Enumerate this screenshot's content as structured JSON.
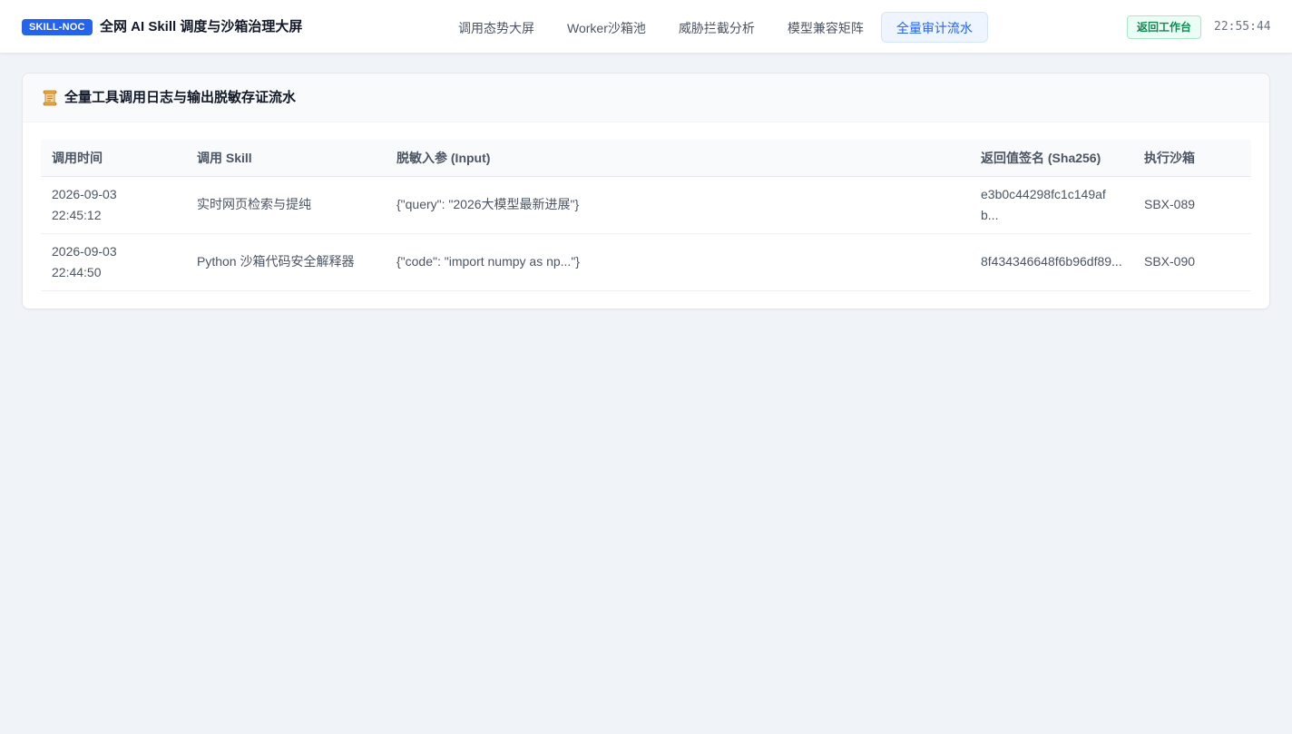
{
  "header": {
    "badge": "SKILL-NOC",
    "title": "全网 AI Skill 调度与沙箱治理大屏",
    "tabs": [
      {
        "label": "调用态势大屏",
        "active": false
      },
      {
        "label": "Worker沙箱池",
        "active": false
      },
      {
        "label": "威胁拦截分析",
        "active": false
      },
      {
        "label": "模型兼容矩阵",
        "active": false
      },
      {
        "label": "全量审计流水",
        "active": true
      }
    ],
    "workbench_button": "返回工作台",
    "clock": "22:55:44"
  },
  "audit_card": {
    "icon": "scroll-icon",
    "title": "全量工具调用日志与输出脱敏存证流水",
    "columns": [
      "调用时间",
      "调用 Skill",
      "脱敏入参 (Input)",
      "返回值签名 (Sha256)",
      "执行沙箱"
    ],
    "rows": [
      {
        "time_date": "2026-09-03",
        "time_clock": "22:45:12",
        "skill": "实时网页检索与提纯",
        "input": "{\"query\": \"2026大模型最新进展\"}",
        "hash": "e3b0c44298fc1c149afb...",
        "sandbox": "SBX-089"
      },
      {
        "time_date": "2026-09-03",
        "time_clock": "22:44:50",
        "skill": "Python 沙箱代码安全解释器",
        "input": "{\"code\": \"import numpy as np...\"}",
        "hash": "8f434346648f6b96df89...",
        "sandbox": "SBX-090"
      }
    ]
  },
  "colors": {
    "accent": "#2563eb",
    "success": "#0f8a55",
    "background": "#f0f3f8"
  }
}
